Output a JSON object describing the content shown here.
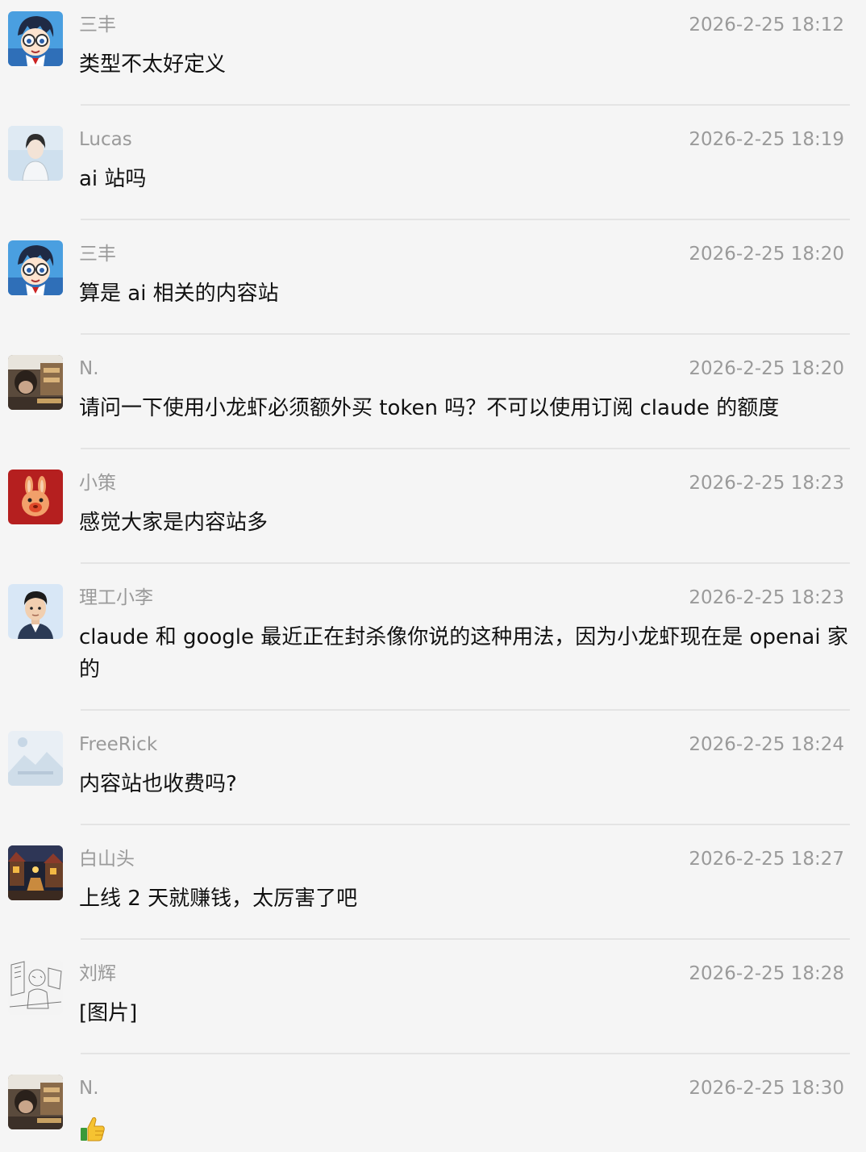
{
  "messages": [
    {
      "name": "三丰",
      "time": "2026-2-25 18:12",
      "text": "类型不太好定义",
      "avatar": "anime-glasses-boy-avatar"
    },
    {
      "name": "Lucas",
      "time": "2026-2-25 18:19",
      "text": "ai 站吗",
      "avatar": "sketch-person-avatar"
    },
    {
      "name": "三丰",
      "time": "2026-2-25 18:20",
      "text": "算是 ai 相关的内容站",
      "avatar": "anime-glasses-boy-avatar"
    },
    {
      "name": "N.",
      "time": "2026-2-25 18:20",
      "text": "请问一下使用小龙虾必须额外买 token 吗？不可以使用订阅 claude 的额度",
      "avatar": "cafe-photo-avatar"
    },
    {
      "name": "小策",
      "time": "2026-2-25 18:23",
      "text": "感觉大家是内容站多",
      "avatar": "rabbit-cartoon-avatar"
    },
    {
      "name": "理工小李",
      "time": "2026-2-25 18:23",
      "text": "claude 和 google 最近正在封杀像你说的这种用法，因为小龙虾现在是 openai 家的",
      "avatar": "3d-man-avatar"
    },
    {
      "name": "FreeRick",
      "time": "2026-2-25 18:24",
      "text": "内容站也收费吗?",
      "avatar": "placeholder-image-avatar"
    },
    {
      "name": "白山头",
      "time": "2026-2-25 18:27",
      "text": "上线 2 天就赚钱，太厉害了吧",
      "avatar": "painting-street-avatar"
    },
    {
      "name": "刘辉",
      "time": "2026-2-25 18:28",
      "text": "[图片]",
      "avatar": "line-sketch-avatar"
    },
    {
      "name": "N.",
      "time": "2026-2-25 18:30",
      "text": "",
      "emoji": "thumbs-up-icon",
      "avatar": "cafe-photo-avatar"
    }
  ]
}
